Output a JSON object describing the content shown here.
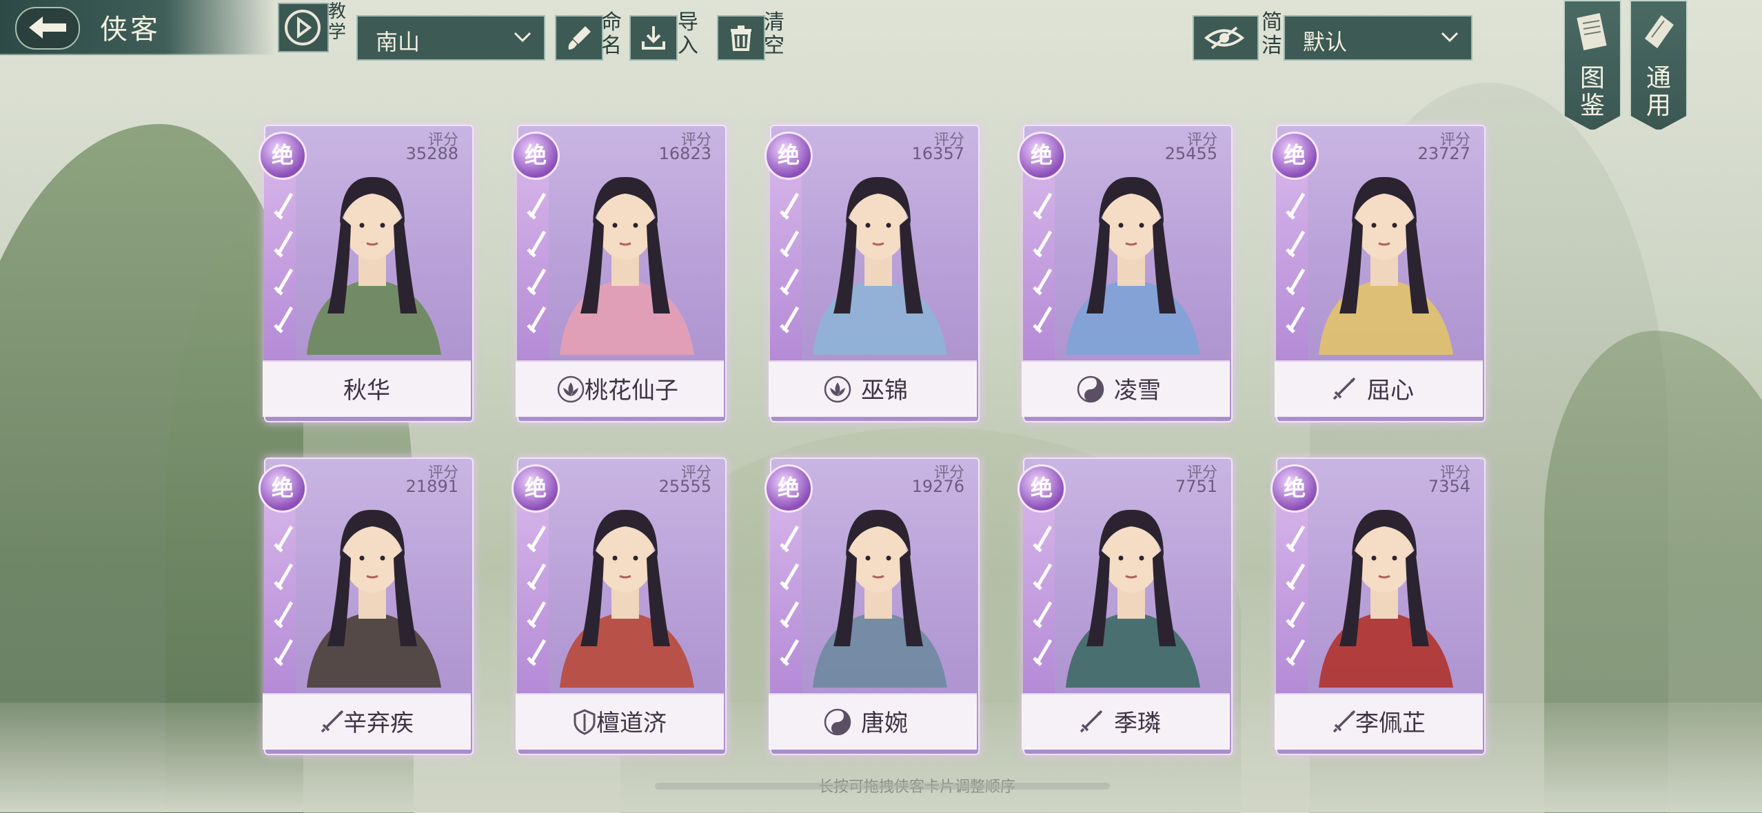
{
  "header": {
    "title": "侠客",
    "teach_label": "教学",
    "team_select": "南山",
    "rename_label": "命名",
    "import_label": "导入",
    "clear_label": "清空",
    "simple_label": "简洁",
    "sort_select": "默认",
    "codex_label": "图鉴",
    "general_label": "通用"
  },
  "score_label": "评分",
  "rarity": "绝",
  "cards": [
    {
      "name": "秋华",
      "score": "35288",
      "sect": "none",
      "color": "#6a8a5a"
    },
    {
      "name": "桃花仙子",
      "score": "16823",
      "sect": "lotus-icon",
      "color": "#e6a0b4"
    },
    {
      "name": "巫锦",
      "score": "16357",
      "sect": "lotus-icon",
      "color": "#8fb4d6"
    },
    {
      "name": "凌雪",
      "score": "25455",
      "sect": "yin-yang-icon",
      "color": "#7ea3d6"
    },
    {
      "name": "屈心",
      "score": "23727",
      "sect": "sword-icon",
      "color": "#e1c36a"
    },
    {
      "name": "辛弃疾",
      "score": "21891",
      "sect": "sword-icon",
      "color": "#4a4038"
    },
    {
      "name": "檀道济",
      "score": "25555",
      "sect": "shield-icon",
      "color": "#b84a3a"
    },
    {
      "name": "唐婉",
      "score": "19276",
      "sect": "yin-yang-icon",
      "color": "#6f8aa0"
    },
    {
      "name": "季璘",
      "score": "7751",
      "sect": "sword-icon",
      "color": "#3e6a66"
    },
    {
      "name": "李佩芷",
      "score": "7354",
      "sect": "sword-icon",
      "color": "#b0332c"
    }
  ],
  "bottom_hint": "长按可拖拽侠客卡片调整顺序"
}
